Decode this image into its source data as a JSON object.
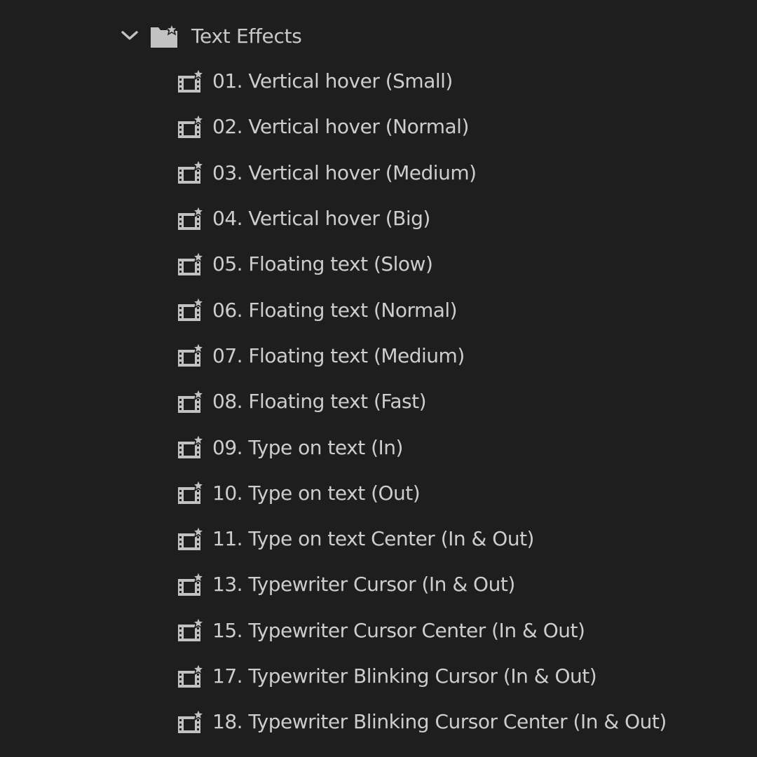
{
  "folder": {
    "label": "Text Effects",
    "expanded": true,
    "chevron_icon": "chevron-down-icon",
    "icon": "folder-star-icon"
  },
  "colors": {
    "background": "#1e1e1e",
    "text": "#c8c8c8",
    "icon": "#c2c2c2"
  },
  "presets": [
    {
      "label": "01. Vertical hover (Small)",
      "icon": "effect-preset-icon"
    },
    {
      "label": "02. Vertical hover (Normal)",
      "icon": "effect-preset-icon"
    },
    {
      "label": "03. Vertical hover (Medium)",
      "icon": "effect-preset-icon"
    },
    {
      "label": "04. Vertical hover (Big)",
      "icon": "effect-preset-icon"
    },
    {
      "label": "05. Floating text (Slow)",
      "icon": "effect-preset-icon"
    },
    {
      "label": "06. Floating text (Normal)",
      "icon": "effect-preset-icon"
    },
    {
      "label": "07. Floating text (Medium)",
      "icon": "effect-preset-icon"
    },
    {
      "label": "08. Floating text (Fast)",
      "icon": "effect-preset-icon"
    },
    {
      "label": "09. Type on text (In)",
      "icon": "effect-preset-icon"
    },
    {
      "label": "10. Type on text (Out)",
      "icon": "effect-preset-icon"
    },
    {
      "label": "11. Type on text Center (In & Out)",
      "icon": "effect-preset-icon"
    },
    {
      "label": "13. Typewriter Cursor (In & Out)",
      "icon": "effect-preset-icon"
    },
    {
      "label": "15. Typewriter Cursor Center (In & Out)",
      "icon": "effect-preset-icon"
    },
    {
      "label": "17. Typewriter Blinking Cursor (In & Out)",
      "icon": "effect-preset-icon"
    },
    {
      "label": "18. Typewriter Blinking Cursor Center (In & Out)",
      "icon": "effect-preset-icon"
    }
  ]
}
